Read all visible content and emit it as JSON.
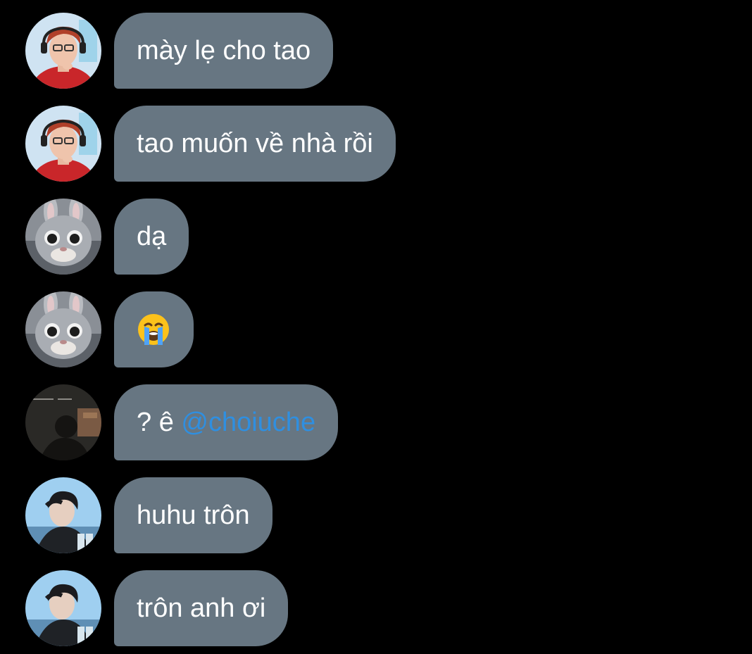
{
  "colors": {
    "background": "#000000",
    "bubble": "#677682",
    "text": "#ffffff",
    "mention": "#2f8fe0"
  },
  "messages": [
    {
      "avatar": "red-hair-person-avatar",
      "text": "mày lẹ cho tao"
    },
    {
      "avatar": "red-hair-person-avatar",
      "text": "tao muốn về nhà rồi"
    },
    {
      "avatar": "rabbit-mascot-avatar",
      "text": "dạ"
    },
    {
      "avatar": "rabbit-mascot-avatar",
      "emoji": "loudly-crying-face-emoji"
    },
    {
      "avatar": "dark-photo-avatar",
      "text": "? ê ",
      "mention": "@choiuche"
    },
    {
      "avatar": "blue-background-person-avatar",
      "text": "huhu trôn"
    },
    {
      "avatar": "blue-background-person-avatar",
      "text": "trôn anh ơi"
    }
  ]
}
